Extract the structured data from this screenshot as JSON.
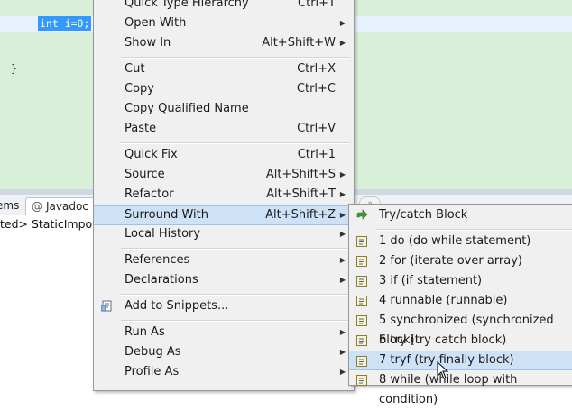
{
  "editor": {
    "selected_code": "int i=0;",
    "closing_brace": "}"
  },
  "bottom_views": {
    "tabs": [
      {
        "label": "ems"
      },
      {
        "label": "Javadoc",
        "icon": "at-icon"
      }
    ],
    "console_line": "ted> StaticImport"
  },
  "context_menu": {
    "items": [
      {
        "label": "Quick Type Hierarchy",
        "accelerator": "Ctrl+T"
      },
      {
        "label": "Open With",
        "submenu": true
      },
      {
        "label": "Show In",
        "accelerator": "Alt+Shift+W",
        "submenu": true
      },
      {
        "label": "Cut",
        "accelerator": "Ctrl+X"
      },
      {
        "label": "Copy",
        "accelerator": "Ctrl+C"
      },
      {
        "label": "Copy Qualified Name"
      },
      {
        "label": "Paste",
        "accelerator": "Ctrl+V"
      },
      {
        "label": "Quick Fix",
        "accelerator": "Ctrl+1"
      },
      {
        "label": "Source",
        "accelerator": "Alt+Shift+S",
        "submenu": true
      },
      {
        "label": "Refactor",
        "accelerator": "Alt+Shift+T",
        "submenu": true
      },
      {
        "label": "Surround With",
        "accelerator": "Alt+Shift+Z",
        "submenu": true,
        "highlighted": true
      },
      {
        "label": "Local History",
        "submenu": true
      },
      {
        "label": "References",
        "submenu": true
      },
      {
        "label": "Declarations",
        "submenu": true
      },
      {
        "label": "Add to Snippets...",
        "icon": "snippets-icon"
      },
      {
        "label": "Run As",
        "submenu": true
      },
      {
        "label": "Debug As",
        "submenu": true
      },
      {
        "label": "Profile As",
        "submenu": true
      }
    ]
  },
  "surround_submenu": {
    "items": [
      {
        "label": "Try/catch Block",
        "icon": "green-arrow-icon"
      },
      {
        "label": "1 do (do while statement)",
        "icon": "template-icon"
      },
      {
        "label": "2 for (iterate over array)",
        "icon": "template-icon"
      },
      {
        "label": "3 if (if statement)",
        "icon": "template-icon"
      },
      {
        "label": "4 runnable (runnable)",
        "icon": "template-icon"
      },
      {
        "label": "5 synchronized (synchronized block)",
        "icon": "template-icon"
      },
      {
        "label": "6 try (try catch block)",
        "icon": "template-icon"
      },
      {
        "label": "7 tryf (try finally block)",
        "icon": "template-icon",
        "highlighted": true
      },
      {
        "label": "8 while (while loop with condition)",
        "icon": "template-icon"
      }
    ]
  },
  "colors": {
    "editor_bg": "#d6efd6",
    "selection": "#3399ff",
    "menu_bg": "#f0f0f0",
    "menu_highlight": "#cde1f7"
  }
}
